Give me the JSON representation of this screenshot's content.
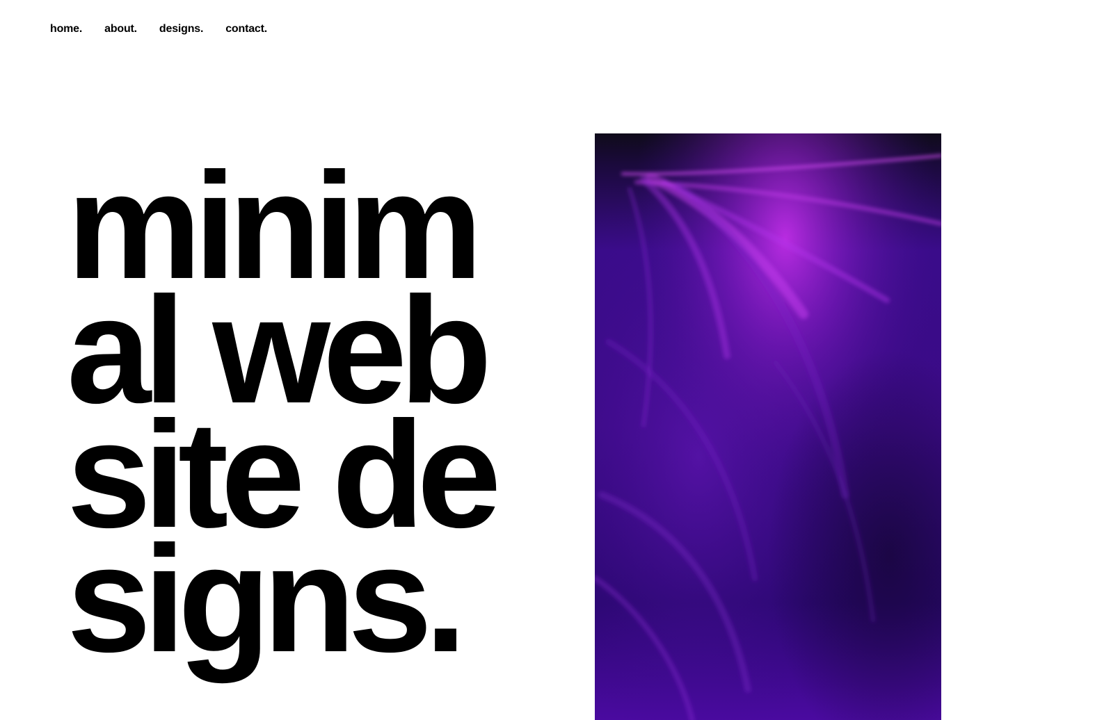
{
  "nav": {
    "items": [
      {
        "label": "home."
      },
      {
        "label": "about."
      },
      {
        "label": "designs."
      },
      {
        "label": "contact."
      }
    ]
  },
  "hero": {
    "title_lines": [
      "minim",
      "al web",
      "site de",
      "signs."
    ]
  },
  "image": {
    "subject": "purple light streaks abstract",
    "colors": {
      "base": "#2a0a63",
      "highlight": "#b12be0",
      "top": "#0f0b1a"
    }
  }
}
